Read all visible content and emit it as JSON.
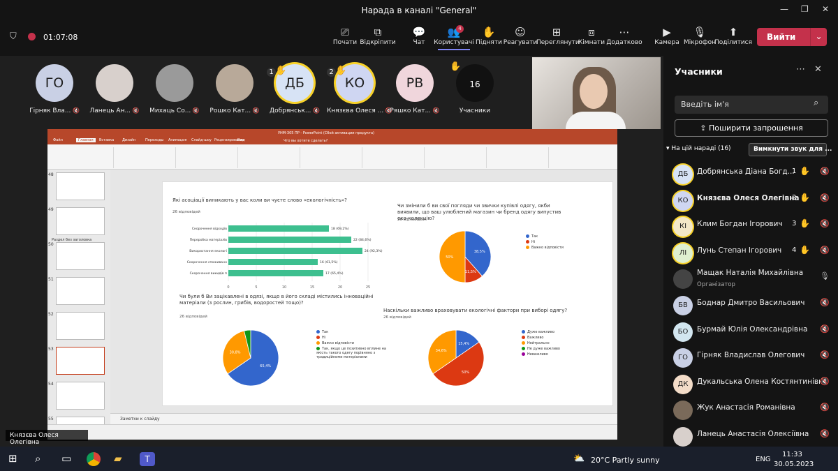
{
  "window": {
    "title": "Нарада в каналі \"General\""
  },
  "toolbar": {
    "timer": "01:07:08",
    "buttons": [
      {
        "label": "Почати",
        "icon": "present-icon"
      },
      {
        "label": "Відкріпити",
        "icon": "popout-icon"
      },
      {
        "label": "Чат",
        "icon": "chat-icon"
      },
      {
        "label": "Користувачі",
        "icon": "people-icon",
        "badge": "4"
      },
      {
        "label": "Підняти",
        "icon": "hand-icon"
      },
      {
        "label": "Реагувати",
        "icon": "smile-icon"
      },
      {
        "label": "Переглянути",
        "icon": "grid-icon"
      },
      {
        "label": "Кімнати",
        "icon": "rooms-icon"
      },
      {
        "label": "Додатково",
        "icon": "more-icon"
      },
      {
        "label": "Камера",
        "icon": "camera-icon"
      },
      {
        "label": "Мікрофон",
        "icon": "mic-icon"
      },
      {
        "label": "Поділитися",
        "icon": "share-icon"
      }
    ],
    "leave": "Вийти"
  },
  "strip": [
    {
      "initials": "ГО",
      "name": "Гірняк Вла...",
      "color": "#c9d0e5"
    },
    {
      "initials": "",
      "name": "Ланець Ан...",
      "color": "#d8d0cc"
    },
    {
      "initials": "",
      "name": "Михаць Со...",
      "color": "#9a9a9a"
    },
    {
      "initials": "",
      "name": "Рошко Кат...",
      "color": "#b8a999"
    },
    {
      "initials": "ДБ",
      "name": "Добрянськ...",
      "color": "#d7e3f5",
      "hand": "1"
    },
    {
      "initials": "КО",
      "name": "Князєва Олеся ...",
      "color": "#cfd6f2",
      "hand": "2"
    },
    {
      "initials": "РВ",
      "name": "Ряшко Кат...",
      "color": "#f0d6dc"
    },
    {
      "initials": "16",
      "name": "Учасники",
      "color": "#111"
    }
  ],
  "presenter": "Князєва Олеся Олегівна",
  "ppt": {
    "title": "УНМ-305 ПР - PowerPoint (Сбой активации продукта)",
    "tabs": [
      "Файл",
      "Главная",
      "Вставка",
      "Дизайн",
      "Переходы",
      "Анимация",
      "Слайд-шоу",
      "Рецензирование",
      "Вид"
    ],
    "tell": "Что вы хотите сделать?",
    "notes": "Заметки к слайду",
    "section": "Раздел без заголовка",
    "thumbs": [
      "48",
      "49",
      "50",
      "51",
      "52",
      "53",
      "54",
      "55"
    ]
  },
  "slide": {
    "q1": "Які асоціації виникають у вас коли ви чуєте слово «екологічність»?",
    "q1sub": "26 відповідей",
    "q2": "Чи змінили б ви свої погляди чи звички купівлі одягу, якби виявили, що ваш улюблений магазин чи бренд одягу випустив еко-колекцію?",
    "q2sub": "26 відповідей",
    "q3": "Чи були б Ви зацікавлені в одязі, якщо в його складі містились інноваційні матеріали (з рослин, грибів, водоростей тощо)?",
    "q3sub": "26 відповідей",
    "q4": "Наскільки важливо враховувати екологічні фактори при виборі одягу?",
    "q4sub": "26 відповідей"
  },
  "chart_data": [
    {
      "type": "bar",
      "orientation": "horizontal",
      "categories": [
        "Скорочення відходів",
        "Переробка матеріалів",
        "Використання екологічно чистих матеріалів",
        "Скорочення споживання ресурсів",
        "Скорочення викидів при виробництві"
      ],
      "values": [
        18,
        22,
        24,
        16,
        17
      ],
      "labels": [
        "18 (69,2%)",
        "22 (84,6%)",
        "24 (92,3%)",
        "16 (61,5%)",
        "17 (65,4%)"
      ],
      "xlim": [
        0,
        25
      ],
      "xticks": [
        "0",
        "5",
        "10",
        "15",
        "20",
        "25"
      ],
      "color": "#3dbf8f"
    },
    {
      "type": "pie",
      "slices": [
        {
          "name": "Так",
          "value": 38.5,
          "label": "38,5%",
          "color": "#3366cc"
        },
        {
          "name": "Ні",
          "value": 11.5,
          "label": "11,5%",
          "color": "#dc3912"
        },
        {
          "name": "Важко відповісти",
          "value": 50,
          "label": "50%",
          "color": "#ff9900"
        }
      ]
    },
    {
      "type": "pie",
      "slices": [
        {
          "name": "Так",
          "value": 65.4,
          "label": "65,4%",
          "color": "#3366cc"
        },
        {
          "name": "Ні",
          "value": 0,
          "label": "",
          "color": "#dc3912"
        },
        {
          "name": "Важко відповісти",
          "value": 30.8,
          "label": "30,8%",
          "color": "#ff9900"
        },
        {
          "name": "Так, якщо це позитивно вплине на якість такого одягу порівняно з традиційними матеріалами",
          "value": 3.8,
          "label": "",
          "color": "#109618"
        }
      ]
    },
    {
      "type": "pie",
      "slices": [
        {
          "name": "Дуже важливо",
          "value": 15.4,
          "label": "15,4%",
          "color": "#3366cc"
        },
        {
          "name": "Важливо",
          "value": 50,
          "label": "50%",
          "color": "#dc3912"
        },
        {
          "name": "Нейтрально",
          "value": 34.6,
          "label": "34,6%",
          "color": "#ff9900"
        },
        {
          "name": "Не дуже важливо",
          "value": 0,
          "label": "",
          "color": "#109618"
        },
        {
          "name": "Неважливо",
          "value": 0,
          "label": "",
          "color": "#990099"
        }
      ]
    }
  ],
  "panel": {
    "title": "Учасники",
    "search_placeholder": "Введіть ім'я",
    "invite": "Поширити запрошення",
    "section": "На цій нараді (16)",
    "mute_all": "Вимкнути звук для ...",
    "people": [
      {
        "initials": "ДБ",
        "name": "Добрянська Діана Богд...",
        "hand": "1",
        "color": "#d7e3f5"
      },
      {
        "initials": "КО",
        "name": "Князєва Олеся Олегівна",
        "hand": "2",
        "color": "#cfd6f2",
        "bold": true
      },
      {
        "initials": "КІ",
        "name": "Клим Богдан Ігорович",
        "hand": "3",
        "color": "#f3e8c8"
      },
      {
        "initials": "ЛІ",
        "name": "Лунь Степан Ігорович",
        "hand": "4",
        "color": "#dff0d0"
      },
      {
        "initials": "",
        "name": "Мащак Наталія Михайлівна",
        "role": "Організатор",
        "color": "#444"
      },
      {
        "initials": "БВ",
        "name": "Боднар Дмитро Васильович",
        "color": "#c9d0e5"
      },
      {
        "initials": "БО",
        "name": "Бурмай Юлія Олександрівна",
        "color": "#d2e6f0"
      },
      {
        "initials": "ГО",
        "name": "Гірняк Владислав Олегович",
        "color": "#c9d0e5"
      },
      {
        "initials": "ДК",
        "name": "Дукальська Олена Костянтинівна",
        "color": "#f3dcc8"
      },
      {
        "initials": "",
        "name": "Жук Анастасія Романівна",
        "color": "#7a6a5a"
      },
      {
        "initials": "",
        "name": "Ланець Анастасія Олексіївна",
        "color": "#d8d0cc"
      }
    ]
  },
  "taskbar": {
    "weather": "20°C  Partly sunny",
    "lang": "ENG",
    "time": "11:33",
    "date": "30.05.2023"
  }
}
